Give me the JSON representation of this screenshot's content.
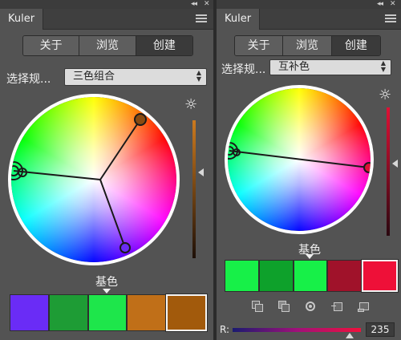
{
  "left": {
    "window_controls": "◂◂",
    "close": "✕",
    "tab_title": "Kuler",
    "tabs": [
      {
        "label": "关于",
        "active": false
      },
      {
        "label": "浏览",
        "active": false
      },
      {
        "label": "创建",
        "active": true
      }
    ],
    "rule_label": "选择规...",
    "rule_value": "三色组合",
    "base_label": "基色",
    "swatches": [
      "#6a2cf6",
      "#1e9c35",
      "#1ee64b",
      "#c06f18",
      "#a25a0c"
    ],
    "selected_swatch": 4,
    "brightness_slider_colors": [
      "#cc7a1e",
      "#1e1008"
    ],
    "brightness_level": 0.62,
    "handle_colors": [
      "#8a4a10",
      "#6a2cf6",
      "#2a2a2a"
    ]
  },
  "right": {
    "window_controls": "◂◂",
    "close": "✕",
    "tab_title": "Kuler",
    "tabs": [
      {
        "label": "关于",
        "active": false
      },
      {
        "label": "浏览",
        "active": false
      },
      {
        "label": "创建",
        "active": true
      }
    ],
    "rule_label": "选择规...",
    "rule_value": "互补色",
    "base_label": "基色",
    "swatches": [
      "#17f048",
      "#0ea12b",
      "#17f048",
      "#a0122a",
      "#ee1038"
    ],
    "selected_swatch": 4,
    "brightness_slider_colors": [
      "#e01035",
      "#2a0810"
    ],
    "brightness_level": 0.56,
    "handle_colors": [
      "#e01035",
      "#2a2a2a"
    ],
    "channel_label": "R:",
    "channel_value": "235",
    "tool_icons": [
      "copy-swatch-icon",
      "paste-swatch-icon",
      "color-picker-icon",
      "add-to-swatches-icon",
      "export-icon"
    ]
  }
}
